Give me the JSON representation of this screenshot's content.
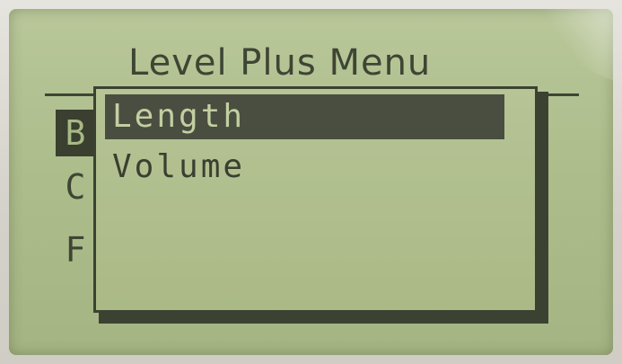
{
  "display": {
    "title": "Level Plus Menu",
    "background_items": [
      {
        "label": "B",
        "selected": true
      },
      {
        "label": "C",
        "selected": false
      },
      {
        "label": "F",
        "selected": false
      }
    ],
    "popup_items": [
      {
        "label": "Length",
        "selected": true
      },
      {
        "label": "Volume",
        "selected": false
      }
    ]
  },
  "colors": {
    "lcd_background": "#adbd8b",
    "lcd_ink": "#3a3f30",
    "selection_fill": "#4a4e40"
  }
}
